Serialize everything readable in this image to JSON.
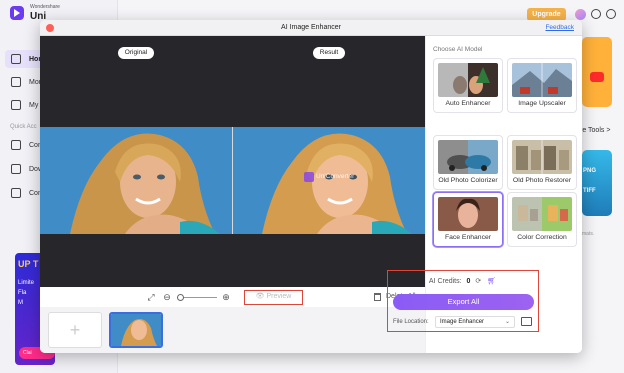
{
  "background_app": {
    "brand_small": "Wondershare",
    "brand_big": "Uni",
    "nav_items": [
      {
        "label": "Hom",
        "active": true
      },
      {
        "label": "Mor",
        "active": false
      },
      {
        "label": "My",
        "active": false
      },
      {
        "label": "Con",
        "active": false
      },
      {
        "label": "Dow",
        "active": false
      },
      {
        "label": "Con",
        "active": false
      }
    ],
    "quick_access": "Quick Acc",
    "upgrade_label": "Upgrade",
    "tools_text": "re Tools >",
    "png_label": "PNG",
    "tiff_label": "TIFF",
    "mats_text": "mats.",
    "promo": {
      "title": "UP T",
      "line1": "Limite",
      "line2": "Fla",
      "line3": "M",
      "cta": "Clai"
    }
  },
  "dialog": {
    "title": "AI Image Enhancer",
    "feedback_label": "Feedback",
    "original_label": "Original",
    "result_label": "Result",
    "watermark_text": "UniConverter",
    "preview_label": "Preview",
    "delete_all_label": "Delete All",
    "add_label": "+",
    "panel_title": "Choose AI Model",
    "models": [
      {
        "label": "Auto Enhancer",
        "selected": false
      },
      {
        "label": "Image Upscaler",
        "selected": false
      },
      {
        "label": "Old Photo Colorizer",
        "selected": false
      },
      {
        "label": "Old Photo Restorer",
        "selected": false
      },
      {
        "label": "Face Enhancer",
        "selected": true
      },
      {
        "label": "Color Correction",
        "selected": false
      }
    ],
    "credits_label": "AI Credits:",
    "credits_value": "0",
    "export_label": "Export All",
    "file_location_label": "File Location:",
    "file_location_value": "Image Enhancer"
  },
  "colors": {
    "accent_purple": "#8a5cf5",
    "highlight_red": "#e0453a",
    "stage_dark": "#26262b",
    "link_blue": "#2f6be8"
  }
}
